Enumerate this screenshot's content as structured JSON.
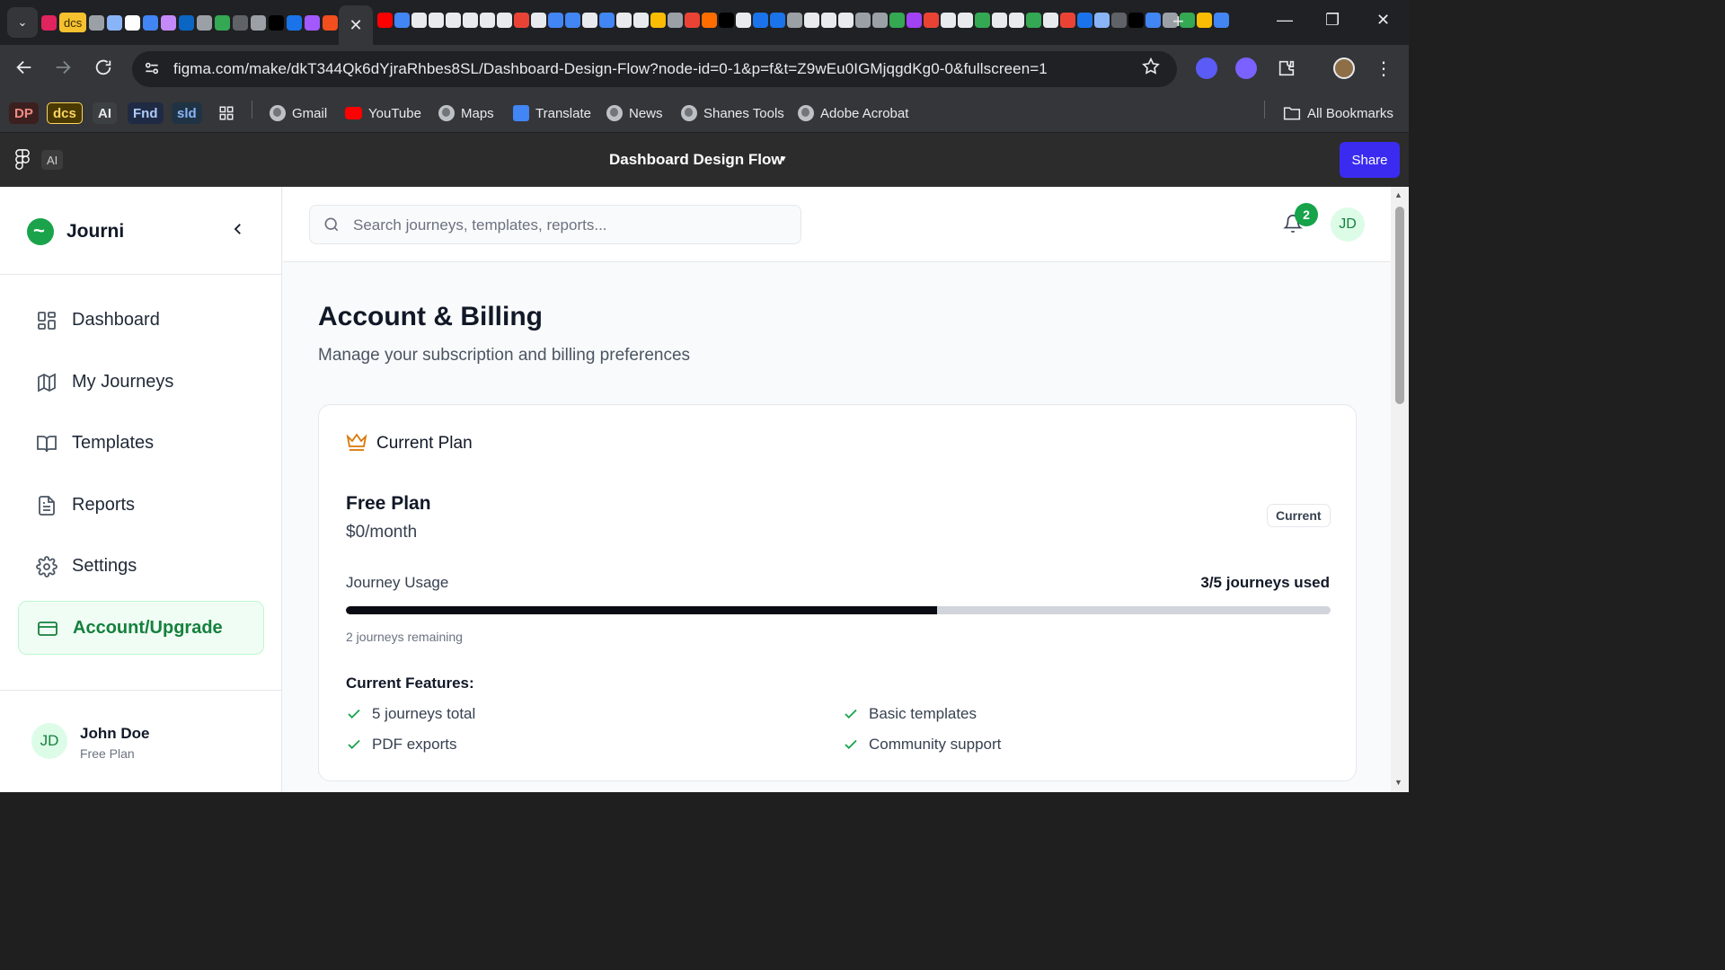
{
  "browser": {
    "tab_strip": {
      "tab_list_label": "⌄",
      "pinned_text_tab": "dcs",
      "active_tab_close": "✕",
      "new_tab_label": "+"
    },
    "window_controls": {
      "minimize": "—",
      "restore": "❐",
      "close": "✕"
    },
    "url": "figma.com/make/dkT344Qk6dYjraRhbes8SL/Dashboard-Design-Flow?node-id=0-1&p=f&t=Z9wEu0IGMjqgdKg0-0&fullscreen=1",
    "bookmarks": {
      "chips": [
        {
          "label": "DP",
          "bg": "#3c1f1f",
          "fg": "#f28b82"
        },
        {
          "label": "dcs",
          "bg": "#4a3a00",
          "fg": "#fdd663"
        },
        {
          "label": "AI",
          "bg": "#3c4043",
          "fg": "#e8eaed"
        },
        {
          "label": "Fnd",
          "bg": "#1f2a44",
          "fg": "#aecbfa"
        },
        {
          "label": "sld",
          "bg": "#1f3344",
          "fg": "#8ab4f8"
        }
      ],
      "links": [
        "Gmail",
        "YouTube",
        "Maps",
        "Translate",
        "News",
        "Shanes Tools",
        "Adobe Acrobat"
      ],
      "all_bookmarks": "All Bookmarks"
    }
  },
  "figma": {
    "ai_label": "AI",
    "file_title": "Dashboard Design Flow",
    "share_label": "Share",
    "share_color": "#3b2bf0"
  },
  "app": {
    "brand": {
      "name": "Journi",
      "color": "#1aa34a"
    },
    "nav": [
      {
        "id": "dashboard",
        "label": "Dashboard",
        "icon": "dashboard-grid-icon",
        "active": false
      },
      {
        "id": "my-journeys",
        "label": "My Journeys",
        "icon": "map-icon",
        "active": false
      },
      {
        "id": "templates",
        "label": "Templates",
        "icon": "book-open-icon",
        "active": false
      },
      {
        "id": "reports",
        "label": "Reports",
        "icon": "file-text-icon",
        "active": false
      },
      {
        "id": "settings",
        "label": "Settings",
        "icon": "gear-icon",
        "active": false
      },
      {
        "id": "account-upgrade",
        "label": "Account/Upgrade",
        "icon": "credit-card-icon",
        "active": true
      }
    ],
    "user": {
      "initials": "JD",
      "name": "John Doe",
      "plan": "Free Plan"
    },
    "topbar": {
      "search_placeholder": "Search journeys, templates, reports...",
      "notification_count": "2",
      "avatar_initials": "JD"
    },
    "page": {
      "title": "Account & Billing",
      "subtitle": "Manage your subscription and billing preferences"
    },
    "plan_card": {
      "header": "Current Plan",
      "plan_name": "Free Plan",
      "price": "$0/month",
      "badge": "Current",
      "usage_label": "Journey Usage",
      "usage_text": "3/5 journeys used",
      "usage_fraction": 0.6,
      "remaining_text": "2 journeys remaining",
      "features_title": "Current Features:",
      "features": [
        "5 journeys total",
        "Basic templates",
        "PDF exports",
        "Community support"
      ]
    },
    "accent_green": "#16a34a",
    "crown_color": "#d97706"
  }
}
